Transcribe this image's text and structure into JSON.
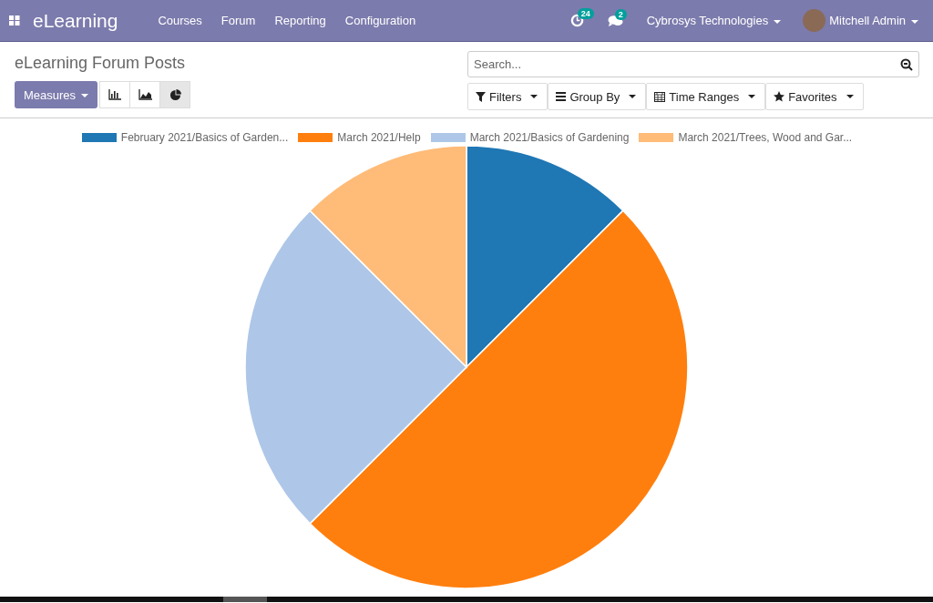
{
  "navbar": {
    "app_name": "eLearning",
    "menu": [
      "Courses",
      "Forum",
      "Reporting",
      "Configuration"
    ],
    "activity_count": "24",
    "message_count": "2",
    "company": "Cybrosys Technologies",
    "user": "Mitchell Admin"
  },
  "control_panel": {
    "title": "eLearning Forum Posts",
    "measures_label": "Measures",
    "views": [
      {
        "kind": "bar",
        "selected": false
      },
      {
        "kind": "line",
        "selected": false
      },
      {
        "kind": "pie",
        "selected": true
      }
    ],
    "search": {
      "placeholder": "Search..."
    },
    "filters": [
      {
        "kind": "filter",
        "label": "Filters"
      },
      {
        "kind": "groupby",
        "label": "Group By"
      },
      {
        "kind": "timerange",
        "label": "Time Ranges"
      },
      {
        "kind": "favorite",
        "label": "Favorites"
      }
    ]
  },
  "chart": {
    "chart_data": {
      "type": "pie",
      "categories": [
        "February 2021/Basics of Garden...",
        "March 2021/Help",
        "March 2021/Basics of Gardening",
        "March 2021/Trees, Wood and Gar..."
      ],
      "series": [
        {
          "colors": [
            "#1f77b4",
            "#ff7f0e",
            "#aec7e8",
            "#ffbb78"
          ],
          "values": [
            12.5,
            50,
            25,
            12.5
          ]
        }
      ]
    }
  }
}
